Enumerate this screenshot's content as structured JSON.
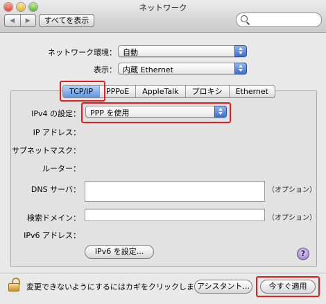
{
  "window": {
    "title": "ネットワーク"
  },
  "toolbar": {
    "show_all_label": "すべてを表示",
    "back_glyph": "◀",
    "forward_glyph": "▶",
    "search_placeholder": ""
  },
  "top": {
    "location_label": "ネットワーク環境：",
    "location_value": "自動",
    "show_label": "表示：",
    "show_value": "内蔵 Ethernet"
  },
  "tabs": [
    {
      "label": "TCP/IP",
      "selected": true
    },
    {
      "label": "PPPoE",
      "selected": false
    },
    {
      "label": "AppleTalk",
      "selected": false
    },
    {
      "label": "プロキシ",
      "selected": false
    },
    {
      "label": "Ethernet",
      "selected": false
    }
  ],
  "tcpip": {
    "ipv4_label": "IPv4 の設定：",
    "ipv4_value": "PPP を使用",
    "ip_address_label": "IP アドレス：",
    "subnet_label": "サブネットマスク：",
    "router_label": "ルーター：",
    "dns_label": "DNS サーバ：",
    "dns_value": "",
    "dns_optional": "（オプション）",
    "search_domain_label": "検索ドメイン：",
    "search_domain_value": "",
    "search_domain_optional": "（オプション）",
    "ipv6_label": "IPv6 アドレス：",
    "ipv6_button": "IPv6 を設定..."
  },
  "help": {
    "glyph": "?"
  },
  "footer": {
    "lock_text": "変更できないようにするにはカギをクリックします。",
    "assistant_button": "アシスタント...",
    "apply_button": "今すぐ適用"
  },
  "colors": {
    "highlight_box": "#e02020",
    "tab_selected": "#5f95e4",
    "popup_arrow": "#3c6fd1"
  }
}
